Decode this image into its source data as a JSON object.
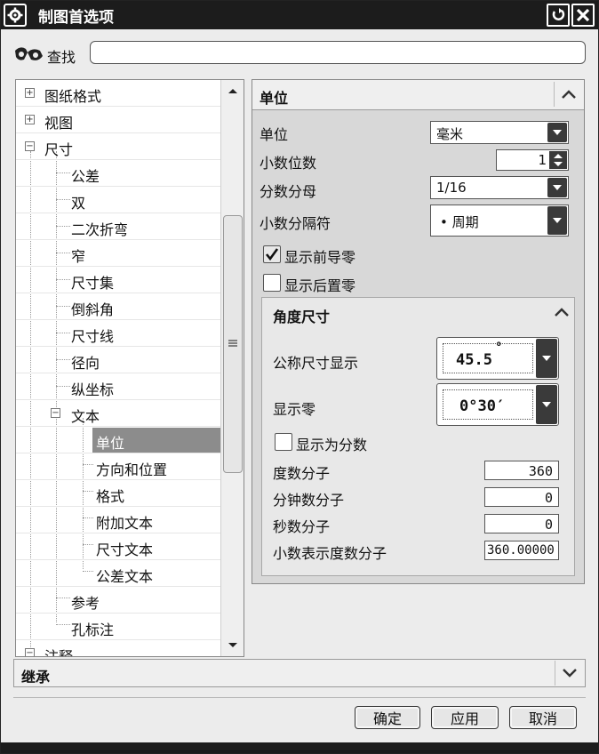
{
  "window": {
    "title": "制图首选项",
    "icons": [
      "gear-icon",
      "reset-icon",
      "close-icon"
    ]
  },
  "search": {
    "label": "查找",
    "value": "",
    "placeholder": ""
  },
  "tree": {
    "items": [
      {
        "label": "图纸格式",
        "state": "collapsed"
      },
      {
        "label": "视图",
        "state": "collapsed"
      },
      {
        "label": "尺寸",
        "state": "expanded"
      },
      {
        "label": "公差"
      },
      {
        "label": "双"
      },
      {
        "label": "二次折弯"
      },
      {
        "label": "窄"
      },
      {
        "label": "尺寸集"
      },
      {
        "label": "倒斜角"
      },
      {
        "label": "尺寸线"
      },
      {
        "label": "径向"
      },
      {
        "label": "纵坐标"
      },
      {
        "label": "文本",
        "state": "expanded"
      },
      {
        "label": "单位",
        "selected": true
      },
      {
        "label": "方向和位置"
      },
      {
        "label": "格式"
      },
      {
        "label": "附加文本"
      },
      {
        "label": "尺寸文本"
      },
      {
        "label": "公差文本"
      },
      {
        "label": "参考"
      },
      {
        "label": "孔标注"
      },
      {
        "label": "注释",
        "state": "expanded"
      }
    ]
  },
  "units": {
    "title": "单位",
    "unit": {
      "label": "单位",
      "value": "毫米"
    },
    "decimals": {
      "label": "小数位数",
      "value": "1"
    },
    "fraction": {
      "label": "分数分母",
      "value": "1/16"
    },
    "separator": {
      "label": "小数分隔符",
      "value": "• 周期"
    },
    "leading_zero": {
      "label": "显示前导零",
      "checked": true
    },
    "trailing_zero": {
      "label": "显示后置零",
      "checked": false
    }
  },
  "angle": {
    "title": "角度尺寸",
    "nominal": {
      "label": "公称尺寸显示",
      "value": "45.5",
      "mark": "°"
    },
    "zero": {
      "label": "显示零",
      "value": "0°30′"
    },
    "as_fraction": {
      "label": "显示为分数",
      "checked": false
    },
    "deg_num": {
      "label": "度数分子",
      "value": "360"
    },
    "min_num": {
      "label": "分钟数分子",
      "value": "0"
    },
    "sec_num": {
      "label": "秒数分子",
      "value": "0"
    },
    "dec_deg_num": {
      "label": "小数表示度数分子",
      "value": "360.00000"
    }
  },
  "inherit": {
    "title": "继承"
  },
  "buttons": {
    "ok": "确定",
    "apply": "应用",
    "cancel": "取消"
  }
}
